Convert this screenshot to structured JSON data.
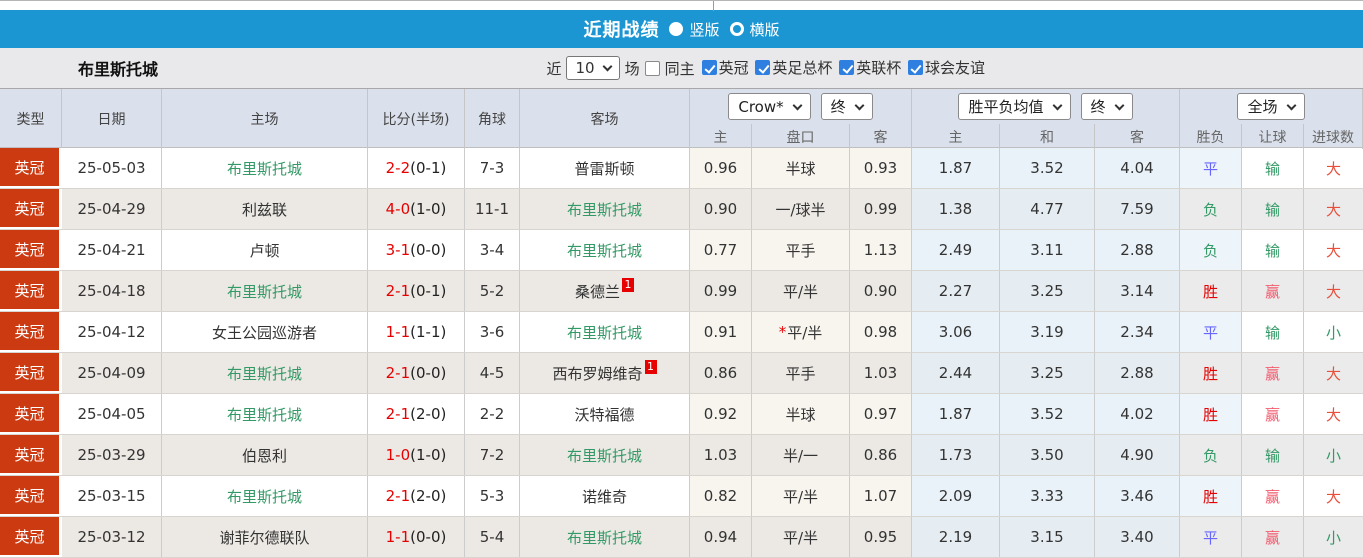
{
  "topbar": {
    "title": "近期战绩",
    "vertical_label": "竖版",
    "horizontal_label": "横版",
    "selected_layout": "竖版"
  },
  "filterbar": {
    "team_name": "布里斯托城",
    "recent_label": "近",
    "recent_count": "10",
    "matches_label": "场",
    "same_home_label": "同主",
    "same_home_checked": false,
    "leagues": [
      {
        "label": "英冠",
        "checked": true
      },
      {
        "label": "英足总杯",
        "checked": true
      },
      {
        "label": "英联杯",
        "checked": true
      },
      {
        "label": "球会友谊",
        "checked": true
      }
    ]
  },
  "table": {
    "headers_left": [
      "类型",
      "日期",
      "主场",
      "比分(半场)",
      "角球",
      "客场"
    ],
    "dropdowns": {
      "odds_company": "Crow*",
      "odds_time1": "终",
      "avg_label": "胜平负均值",
      "odds_time2": "终",
      "scope": "全场"
    },
    "sub_headers": [
      "主",
      "盘口",
      "客",
      "主",
      "和",
      "客",
      "胜负",
      "让球",
      "进球数"
    ],
    "rows": [
      {
        "type": "英冠",
        "date": "25-05-03",
        "home": "布里斯托城",
        "home_self": true,
        "home_card": "",
        "score": "2-2",
        "half": "(0-1)",
        "corners": "7-3",
        "away": "普雷斯顿",
        "away_self": false,
        "away_card": "",
        "o1": "0.96",
        "star": "",
        "handicap": "半球",
        "o2": "0.93",
        "a1": "1.87",
        "a2": "3.52",
        "a3": "4.04",
        "r1": "平",
        "r2": "输",
        "r3": "大"
      },
      {
        "type": "英冠",
        "date": "25-04-29",
        "home": "利兹联",
        "home_self": false,
        "home_card": "",
        "score": "4-0",
        "half": "(1-0)",
        "corners": "11-1",
        "away": "布里斯托城",
        "away_self": true,
        "away_card": "",
        "o1": "0.90",
        "star": "",
        "handicap": "一/球半",
        "o2": "0.99",
        "a1": "1.38",
        "a2": "4.77",
        "a3": "7.59",
        "r1": "负",
        "r2": "输",
        "r3": "大"
      },
      {
        "type": "英冠",
        "date": "25-04-21",
        "home": "卢顿",
        "home_self": false,
        "home_card": "",
        "score": "3-1",
        "half": "(0-0)",
        "corners": "3-4",
        "away": "布里斯托城",
        "away_self": true,
        "away_card": "",
        "o1": "0.77",
        "star": "",
        "handicap": "平手",
        "o2": "1.13",
        "a1": "2.49",
        "a2": "3.11",
        "a3": "2.88",
        "r1": "负",
        "r2": "输",
        "r3": "大"
      },
      {
        "type": "英冠",
        "date": "25-04-18",
        "home": "布里斯托城",
        "home_self": true,
        "home_card": "",
        "score": "2-1",
        "half": "(0-1)",
        "corners": "5-2",
        "away": "桑德兰",
        "away_self": false,
        "away_card": "1",
        "o1": "0.99",
        "star": "",
        "handicap": "平/半",
        "o2": "0.90",
        "a1": "2.27",
        "a2": "3.25",
        "a3": "3.14",
        "r1": "胜",
        "r2": "赢",
        "r3": "大"
      },
      {
        "type": "英冠",
        "date": "25-04-12",
        "home": "女王公园巡游者",
        "home_self": false,
        "home_card": "",
        "score": "1-1",
        "half": "(1-1)",
        "corners": "3-6",
        "away": "布里斯托城",
        "away_self": true,
        "away_card": "",
        "o1": "0.91",
        "star": "*",
        "handicap": "平/半",
        "o2": "0.98",
        "a1": "3.06",
        "a2": "3.19",
        "a3": "2.34",
        "r1": "平",
        "r2": "输",
        "r3": "小"
      },
      {
        "type": "英冠",
        "date": "25-04-09",
        "home": "布里斯托城",
        "home_self": true,
        "home_card": "",
        "score": "2-1",
        "half": "(0-0)",
        "corners": "4-5",
        "away": "西布罗姆维奇",
        "away_self": false,
        "away_card": "1",
        "o1": "0.86",
        "star": "",
        "handicap": "平手",
        "o2": "1.03",
        "a1": "2.44",
        "a2": "3.25",
        "a3": "2.88",
        "r1": "胜",
        "r2": "赢",
        "r3": "大"
      },
      {
        "type": "英冠",
        "date": "25-04-05",
        "home": "布里斯托城",
        "home_self": true,
        "home_card": "",
        "score": "2-1",
        "half": "(2-0)",
        "corners": "2-2",
        "away": "沃特福德",
        "away_self": false,
        "away_card": "",
        "o1": "0.92",
        "star": "",
        "handicap": "半球",
        "o2": "0.97",
        "a1": "1.87",
        "a2": "3.52",
        "a3": "4.02",
        "r1": "胜",
        "r2": "赢",
        "r3": "大"
      },
      {
        "type": "英冠",
        "date": "25-03-29",
        "home": "伯恩利",
        "home_self": false,
        "home_card": "",
        "score": "1-0",
        "half": "(1-0)",
        "corners": "7-2",
        "away": "布里斯托城",
        "away_self": true,
        "away_card": "",
        "o1": "1.03",
        "star": "",
        "handicap": "半/一",
        "o2": "0.86",
        "a1": "1.73",
        "a2": "3.50",
        "a3": "4.90",
        "r1": "负",
        "r2": "输",
        "r3": "小"
      },
      {
        "type": "英冠",
        "date": "25-03-15",
        "home": "布里斯托城",
        "home_self": true,
        "home_card": "",
        "score": "2-1",
        "half": "(2-0)",
        "corners": "5-3",
        "away": "诺维奇",
        "away_self": false,
        "away_card": "",
        "o1": "0.82",
        "star": "",
        "handicap": "平/半",
        "o2": "1.07",
        "a1": "2.09",
        "a2": "3.33",
        "a3": "3.46",
        "r1": "胜",
        "r2": "赢",
        "r3": "大"
      },
      {
        "type": "英冠",
        "date": "25-03-12",
        "home": "谢菲尔德联队",
        "home_self": false,
        "home_card": "",
        "score": "1-1",
        "half": "(0-0)",
        "corners": "5-4",
        "away": "布里斯托城",
        "away_self": true,
        "away_card": "",
        "o1": "0.94",
        "star": "",
        "handicap": "平/半",
        "o2": "0.95",
        "a1": "2.19",
        "a2": "3.15",
        "a3": "3.40",
        "r1": "平",
        "r2": "赢",
        "r3": "小"
      }
    ]
  },
  "colors": {
    "accent_blue": "#1b96d3",
    "type_badge_red": "#cc3a12",
    "score_red": "#e60000",
    "team_green": "#339966",
    "result_win_red": "#e60000",
    "result_draw_blue": "#6666ff",
    "result_lose_green": "#339966",
    "result_cover_pink": "#f25b6e",
    "result_big_red": "#e8503c",
    "checkbox_blue": "#2e7fe0",
    "header_bg": "#dbe1ec",
    "avg_col_bg": "#e9f2f8"
  }
}
